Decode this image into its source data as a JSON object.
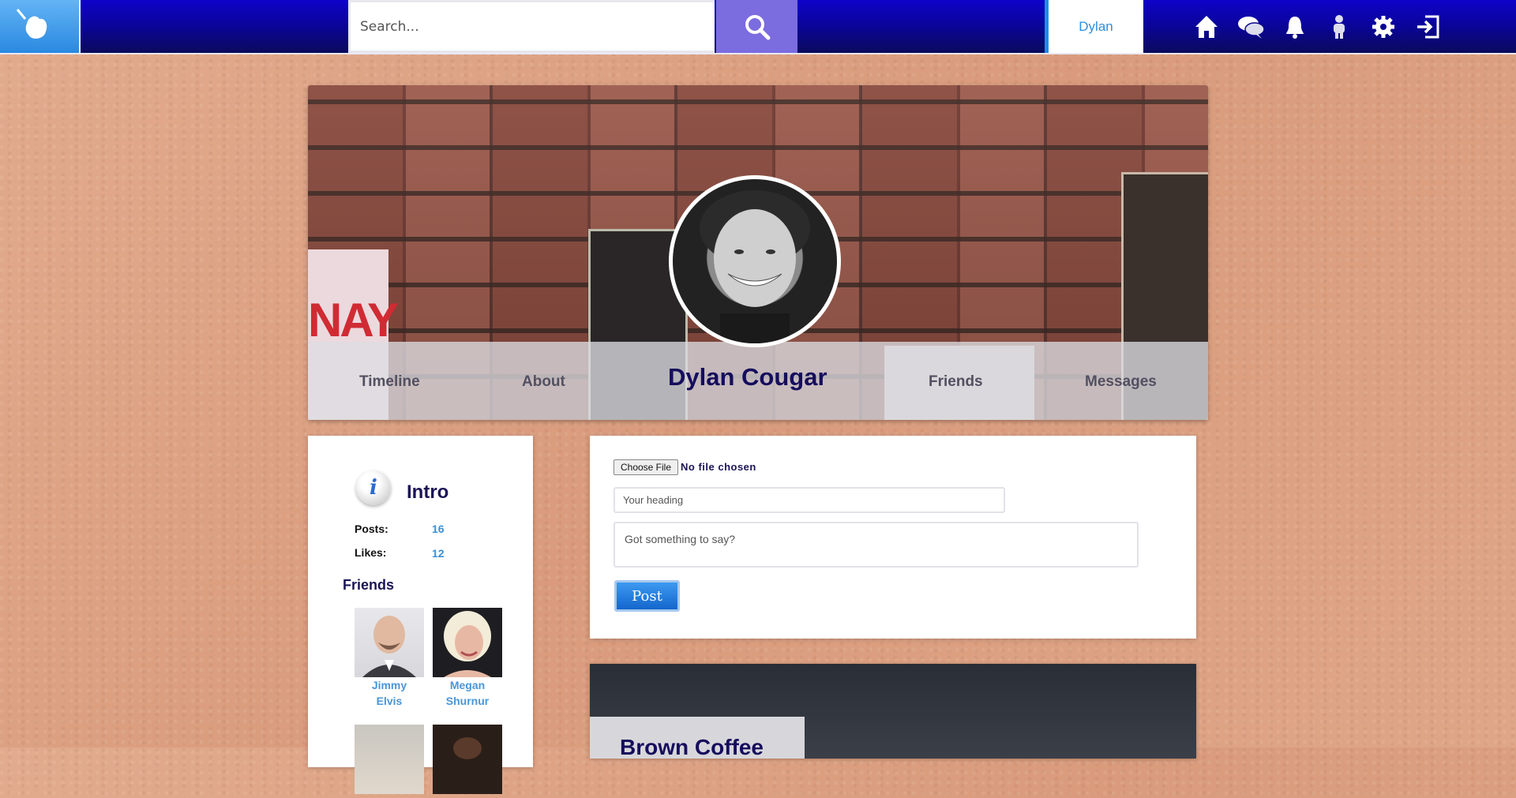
{
  "topbar": {
    "search_placeholder": "Search...",
    "username": "Dylan",
    "icons": [
      "home-icon",
      "chat-icon",
      "bell-icon",
      "people-icon",
      "gear-icon",
      "logout-icon"
    ]
  },
  "profile": {
    "name": "Dylan Cougar",
    "tabs": [
      "Timeline",
      "About",
      "Friends",
      "Messages"
    ],
    "cover_poster_text": "NAY"
  },
  "intro": {
    "title": "Intro",
    "stats": [
      {
        "label": "Posts:",
        "value": "16"
      },
      {
        "label": "Likes:",
        "value": "12"
      }
    ],
    "friends_title": "Friends",
    "friends": [
      {
        "name_line1": "Jimmy",
        "name_line2": "Elvis"
      },
      {
        "name_line1": "Megan",
        "name_line2": "Shurnur"
      }
    ]
  },
  "composer": {
    "file_button": "Choose File",
    "file_status": "No file chosen",
    "heading_placeholder": "Your heading",
    "body_placeholder": "Got something to say?",
    "post_button": "Post"
  },
  "post": {
    "title": "Brown Coffee"
  },
  "colors": {
    "topbar": "#0a0592",
    "accent": "#2b8fe1",
    "search_button": "#7b6ce0",
    "name": "#150d5c"
  }
}
